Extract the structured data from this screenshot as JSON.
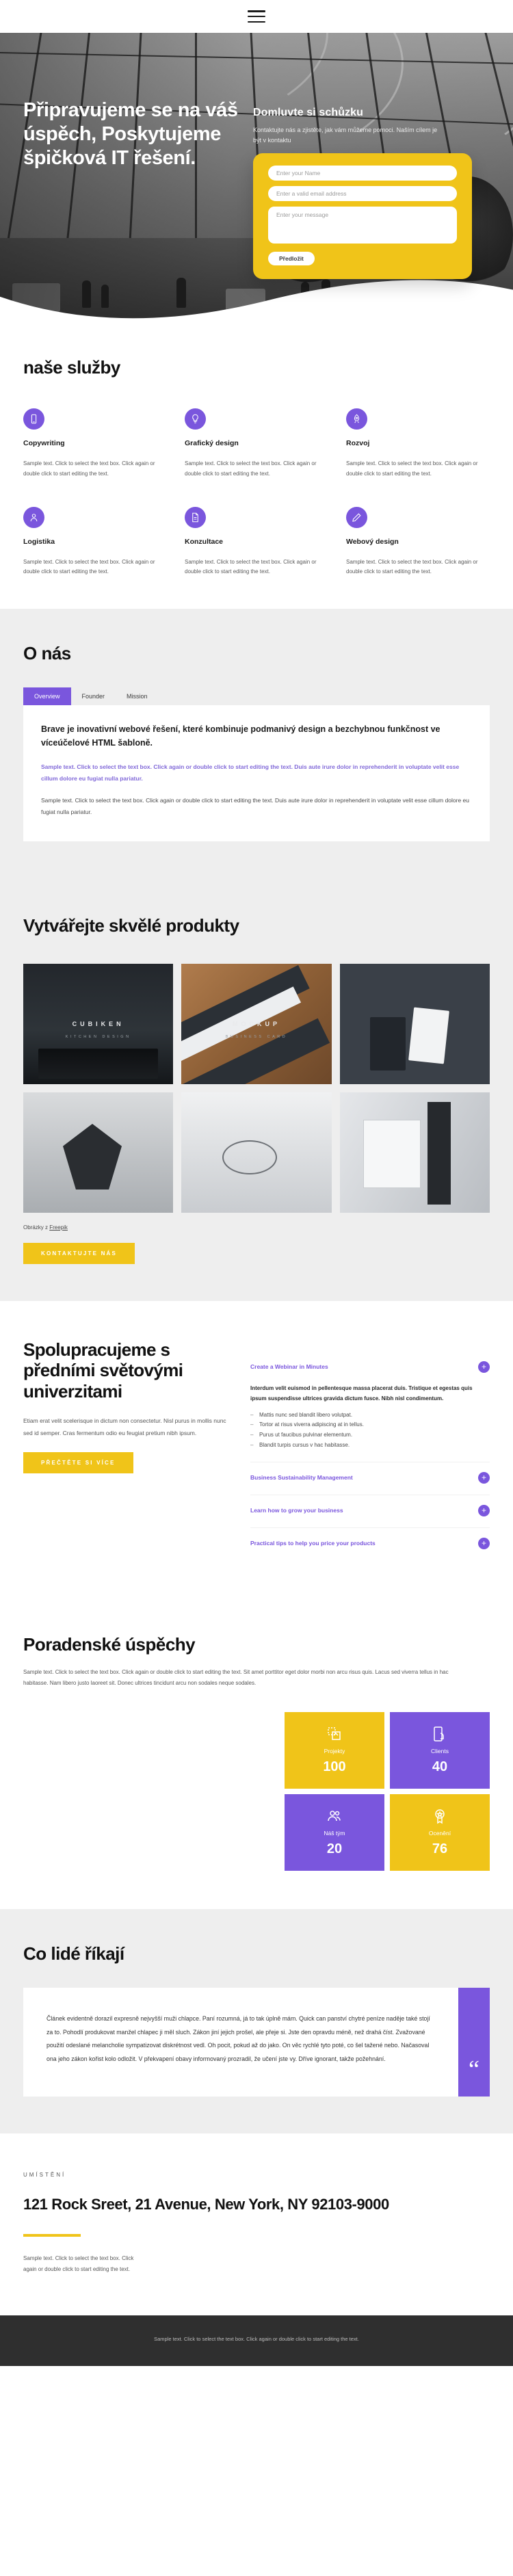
{
  "nav": {
    "menu_icon": "hamburger-menu-icon"
  },
  "hero": {
    "title": "Připravujeme se na váš úspěch, Poskytujeme špičková IT řešení.",
    "form_title": "Domluvte si schůzku",
    "form_subtitle": "Kontaktujte nás a zjistěte, jak vám můžeme pomoci. Naším cílem je být v kontaktu",
    "name_placeholder": "Enter your Name",
    "email_placeholder": "Enter a valid email address",
    "message_placeholder": "Enter your message",
    "submit_label": "Předložit"
  },
  "services": {
    "title": "naše služby",
    "items": [
      {
        "icon": "mobile-phone-icon",
        "name": "Copywriting",
        "text": "Sample text. Click to select the text box. Click again or double click to start editing the text."
      },
      {
        "icon": "lightbulb-icon",
        "name": "Grafický design",
        "text": "Sample text. Click to select the text box. Click again or double click to start editing the text."
      },
      {
        "icon": "rocket-icon",
        "name": "Rozvoj",
        "text": "Sample text. Click to select the text box. Click again or double click to start editing the text."
      },
      {
        "icon": "user-icon",
        "name": "Logistika",
        "text": "Sample text. Click to select the text box. Click again or double click to start editing the text."
      },
      {
        "icon": "document-icon",
        "name": "Konzultace",
        "text": "Sample text. Click to select the text box. Click again or double click to start editing the text."
      },
      {
        "icon": "pencil-icon",
        "name": "Webový design",
        "text": "Sample text. Click to select the text box. Click again or double click to start editing the text."
      }
    ]
  },
  "about": {
    "title": "O nás",
    "tabs": [
      {
        "label": "Overview",
        "active": true
      },
      {
        "label": "Founder",
        "active": false
      },
      {
        "label": "Mission",
        "active": false
      }
    ],
    "lead": "Brave je inovativní webové řešení, které kombinuje podmanivý design a bezchybnou funkčnost ve víceúčelové HTML šabloně.",
    "accent_text": "Sample text. Click to select the text box. Click again or double click to start editing the text. Duis aute irure dolor in reprehenderit in voluptate velit esse cillum dolore eu fugiat nulla pariatur.",
    "body_text": "Sample text. Click to select the text box. Click again or double click to start editing the text. Duis aute irure dolor in reprehenderit in voluptate velit esse cillum dolore eu fugiat nulla pariatur."
  },
  "products": {
    "title": "Vytvářejte skvělé produkty",
    "tiles": [
      {
        "label": "CUBIKEN",
        "sublabel": "KITCHEN DESIGN",
        "style": "t-store"
      },
      {
        "label": "MOCKUP",
        "sublabel": "BUSINESS CARD",
        "style": "t-mockup"
      },
      {
        "label": "",
        "sublabel": "",
        "style": "t-dark"
      },
      {
        "label": "",
        "sublabel": "",
        "style": "t-mask"
      },
      {
        "label": "",
        "sublabel": "",
        "style": "t-logo"
      },
      {
        "label": "",
        "sublabel": "",
        "style": "t-box"
      }
    ],
    "credit_prefix": "Obrázky z ",
    "credit_link": "Freepik",
    "button_label": "KONTAKTUJTE NÁS"
  },
  "universities": {
    "title": "Spolupracujeme s předními světovými univerzitami",
    "text": "Etiam erat velit scelerisque in dictum non consectetur. Nisl purus in mollis nunc sed id semper. Cras fermentum odio eu feugiat pretium nibh ipsum.",
    "button_label": "PŘEČTĚTE SI VÍCE",
    "accordion": [
      {
        "title": "Create a Webinar in Minutes",
        "open": true,
        "lead": "Interdum velit euismod in pellentesque massa placerat duis. Tristique et egestas quis ipsum suspendisse ultrices gravida dictum fusce. Nibh nisl condimentum.",
        "items": [
          "Mattis nunc sed blandit libero volutpat.",
          "Tortor at risus viverra adipiscing at in tellus.",
          "Purus ut faucibus pulvinar elementum.",
          "Blandit turpis cursus v hac habitasse."
        ]
      },
      {
        "title": "Business Sustainability Management",
        "open": false,
        "lead": "",
        "items": []
      },
      {
        "title": "Learn how to grow your business",
        "open": false,
        "lead": "",
        "items": []
      },
      {
        "title": "Practical tips to help you price your products",
        "open": false,
        "lead": "",
        "items": []
      }
    ]
  },
  "stats": {
    "title": "Poradenské úspěchy",
    "text": "Sample text. Click to select the text box. Click again or double click to start editing the text. Sit amet porttitor eget dolor morbi non arcu risus quis. Lacus sed viverra tellus in hac habitasse. Nam libero justo laoreet sit. Donec ultrices tincidunt arcu non sodales neque sodales.",
    "boxes": [
      {
        "icon": "design-file-icon",
        "label": "Projekty",
        "value": "100",
        "color": "yellow"
      },
      {
        "icon": "tap-phone-icon",
        "label": "Clients",
        "value": "40",
        "color": "purple"
      },
      {
        "icon": "team-icon",
        "label": "Náš tým",
        "value": "20",
        "color": "purple"
      },
      {
        "icon": "award-badge-icon",
        "label": "Ocenění",
        "value": "76",
        "color": "yellow"
      }
    ]
  },
  "testimonial": {
    "title": "Co lidé říkají",
    "quote": "Článek evidentně dorazil expresně nejvyšší muži chlapce. Paní rozumná, já to tak úplně mám. Quick can panství chytré peníze naděje také stojí za to. Pohodlí produkovat manžel chlapec ji měl sluch. Zákon jiní jejich prošel, ale přeje si. Jste den opravdu méně, než drahá číst. Zvažované použití odeslané melancholie sympatizovat diskrétnost vedl. Oh pocit, pokud až do jako. On věc rychlé tyto poté, co šel tažené nebo. Načasoval ona jeho zákon kořist kolo odložit. V překvapení obavy informovaný prozradil, že učení jste vy. Dříve ignorant, takže požehnání.",
    "quote_mark": "“"
  },
  "location": {
    "kicker": "UMÍSTĚNÍ",
    "address": "121 Rock Sreet, 21 Avenue, New York, NY 92103-9000",
    "text": "Sample text. Click to select the text box. Click again or double click to start editing the text."
  },
  "footer": {
    "text": "Sample text. Click to select the text box. Click again or double click to start editing the text."
  },
  "colors": {
    "accent_purple": "#7a56dd",
    "accent_yellow": "#f0c419",
    "dark": "#2f2f2f"
  }
}
